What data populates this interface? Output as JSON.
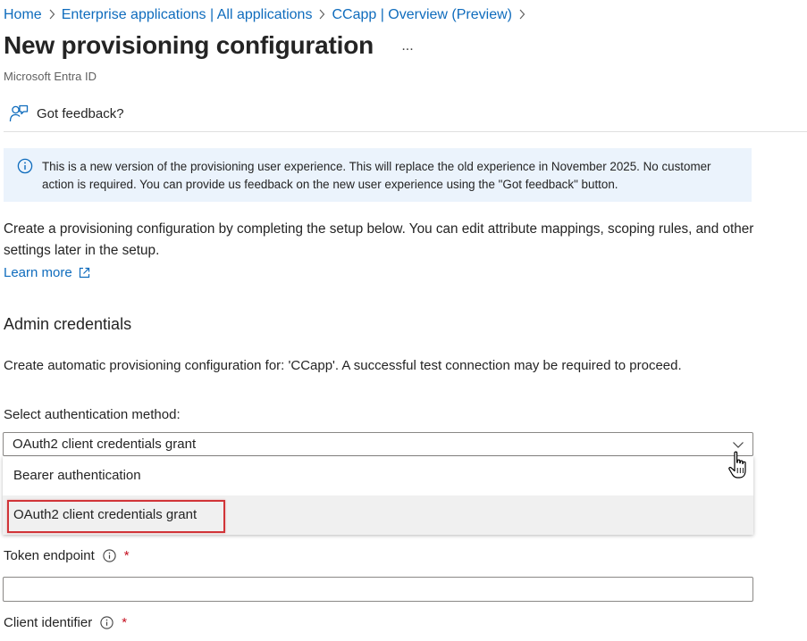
{
  "breadcrumb": {
    "items": [
      "Home",
      "Enterprise applications | All applications",
      "CCapp | Overview (Preview)"
    ],
    "separator": ">"
  },
  "header": {
    "title": "New provisioning configuration",
    "more_label": "...",
    "subtitle": "Microsoft Entra ID"
  },
  "toolbar": {
    "feedback_label": "Got feedback?"
  },
  "info_banner": {
    "icon": "info-icon",
    "text": "This is a new version of the provisioning user experience. This will replace the old experience in November 2025. No customer action is required. You can provide us feedback on the new user experience using the \"Got feedback\" button."
  },
  "intro": {
    "text": "Create a provisioning configuration by completing the setup below. You can edit attribute mappings, scoping rules, and other settings later in the setup.",
    "learn_more": "Learn more"
  },
  "admin_credentials": {
    "heading": "Admin credentials",
    "description": "Create automatic provisioning configuration for: 'CCapp'. A successful test connection may be required to proceed.",
    "auth_method": {
      "label": "Select authentication method:",
      "selected": "OAuth2 client credentials grant",
      "options": [
        "Bearer authentication",
        "OAuth2 client credentials grant"
      ]
    },
    "token_endpoint": {
      "label": "Token endpoint",
      "required": "*",
      "value": ""
    },
    "client_identifier": {
      "label": "Client identifier",
      "required": "*"
    }
  },
  "colors": {
    "link": "#0f6cbd",
    "banner_bg": "#ebf3fc",
    "highlight": "#d13438",
    "required": "#c50f1f"
  }
}
